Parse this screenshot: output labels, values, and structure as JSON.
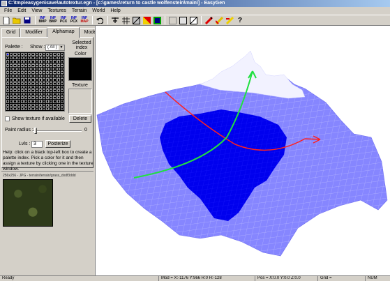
{
  "window": {
    "title": "C:\\tmp\\easygen\\save\\autotextur.egn - [c:\\games\\return to castle wolfenstein\\main\\] - EasyGen"
  },
  "menu": {
    "items": [
      "File",
      "Edit",
      "View",
      "Textures",
      "Terrain",
      "World",
      "Help"
    ]
  },
  "toolbar": {
    "bmp_top_label": "INF",
    "bmp_label": "BMP",
    "pcx_label": "PCX",
    "map_label": "MAP",
    "help_label": "?"
  },
  "tabs": {
    "items": [
      "Grid",
      "Modifier",
      "Alphamap",
      "Models"
    ],
    "active_index": 2
  },
  "alphamap": {
    "palette_label": "Palette :",
    "show_label": "Show :",
    "show_value": "( All )",
    "selected_index_label": "Selected index",
    "color_label": "Color",
    "texture_label": "Texture",
    "show_texture_label": "Show texture if available",
    "delete_label": "Delete",
    "paint_radius_label": "Paint radius :",
    "paint_radius_value": "0",
    "lvls_label": "Lvls :",
    "lvls_value": "3",
    "posterize_label": "Posterize"
  },
  "help_text": "Help: click on a black top-left box to create a palette index. Pick a color for it and then assign a texture by clicking one in the texture window.",
  "texture_preview": {
    "info": "256x256 - JPG - terrain/terrain/grass_dxdf3ddd"
  },
  "status": {
    "ready": "Ready",
    "mouse": "Mod = X:-1176 Y:966 R:0 H:-128",
    "pos": "Pos = X:0.0 Y:0.0 Z:0.0",
    "grid": "Grid =",
    "num": "NUM"
  },
  "colors": {
    "terrain_light": "#8a8aff",
    "terrain_dark": "#0000ee",
    "axis_red": "#ff2020",
    "axis_green": "#20e040"
  }
}
